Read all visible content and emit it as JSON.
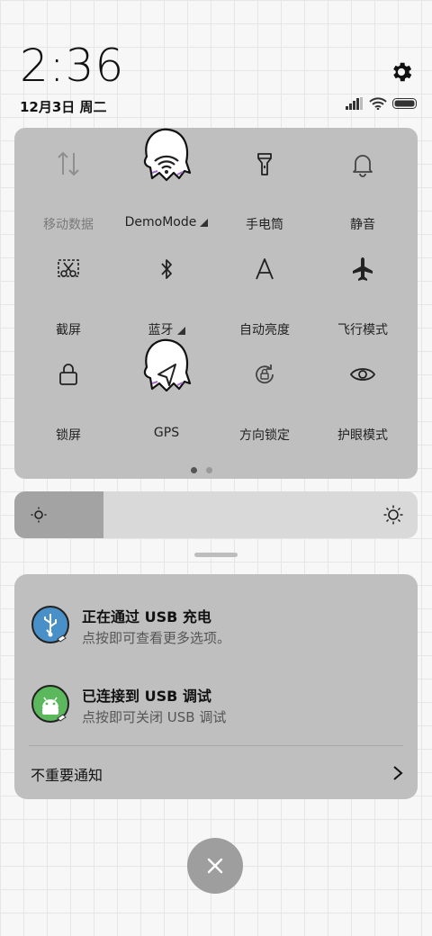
{
  "header": {
    "time": "2:36",
    "date": "12月3日 周二"
  },
  "quick_settings": {
    "tiles": [
      {
        "label": "移动数据",
        "icon": "mobile-data-icon",
        "state": "disabled"
      },
      {
        "label": "DemoMode",
        "icon": "wifi-icon",
        "state": "on",
        "has_more": true
      },
      {
        "label": "手电筒",
        "icon": "flashlight-icon",
        "state": "off"
      },
      {
        "label": "静音",
        "icon": "bell-icon",
        "state": "off"
      },
      {
        "label": "截屏",
        "icon": "scissors-icon",
        "state": "off"
      },
      {
        "label": "蓝牙",
        "icon": "bluetooth-icon",
        "state": "off",
        "has_more": true
      },
      {
        "label": "自动亮度",
        "icon": "auto-brightness-icon",
        "state": "off"
      },
      {
        "label": "飞行模式",
        "icon": "airplane-icon",
        "state": "off"
      },
      {
        "label": "锁屏",
        "icon": "lock-icon",
        "state": "off"
      },
      {
        "label": "GPS",
        "icon": "navigation-arrow-icon",
        "state": "on"
      },
      {
        "label": "方向锁定",
        "icon": "rotation-lock-icon",
        "state": "off"
      },
      {
        "label": "护眼模式",
        "icon": "eye-icon",
        "state": "off"
      }
    ],
    "page_count": 2,
    "current_page": 1
  },
  "brightness": {
    "level": 0.22
  },
  "notifications": [
    {
      "title": "正在通过 USB 充电",
      "subtitle": "点按即可查看更多选项。",
      "icon": "usb-icon",
      "color": "#4a90c8"
    },
    {
      "title": "已连接到 USB 调试",
      "subtitle": "点按即可关闭 USB 调试",
      "icon": "android-icon",
      "color": "#5cb85c"
    }
  ],
  "notification_footer": {
    "label": "不重要通知"
  },
  "colors": {
    "panel": "#bfbfbf",
    "background": "#f7f7f7",
    "clear_button": "#9e9e9e"
  }
}
